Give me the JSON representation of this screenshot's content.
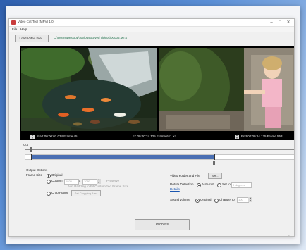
{
  "window": {
    "title": "Video Cut Tool (MPV) 1.0",
    "controls": {
      "minimize": "–",
      "maximize": "□",
      "close": "✕"
    }
  },
  "menu": {
    "file": "File",
    "help": "Help"
  },
  "toolbar": {
    "load_label": "Load Video File...",
    "file_path": "C:\\Users\\Desktop\\Various\\Saved videos\\00006.MTS"
  },
  "timeline": {
    "start_text": "Start 00:00:01.034  Frame 45",
    "center_text": "<< 00:00:24.125  Frame 611 >>",
    "end_text": "End 00:00:24.125  Frame 553"
  },
  "cut": {
    "label": "Cut",
    "selection_start_fraction": 0.02,
    "selection_end_fraction": 0.7,
    "position_fraction": 0.7
  },
  "output": {
    "section_label": "Output Options",
    "frame_size_label": "Frame Size",
    "original_label": "Original",
    "custom_label": "Custom",
    "width_placeholder": "1920",
    "x_label": "x",
    "height_placeholder": "1080",
    "preserve_label": "Preserve",
    "scale_hint": "Add Padding to Fit Customized Frame Size",
    "crop_label": "Crop Frame",
    "set_crop_label": "Set Cropping Area",
    "folder_label": "Video Folder and File",
    "folder_button": "Set...",
    "detect_label": "Rotate Detection",
    "auto_label": "Auto-cut",
    "set_to_label": "Set to",
    "set_to_value": "0 degrees",
    "details_label": "Details",
    "sound_label": "Sound volume",
    "sound_original_label": "Original",
    "change_to_label": "Change To",
    "change_value": "100",
    "process_label": "Process"
  },
  "icons": {
    "app": "video-cut-icon",
    "cursor": "mouse-cursor-icon"
  },
  "colors": {
    "accent": "#4a6fb3",
    "path_text": "#1f6f4a"
  }
}
